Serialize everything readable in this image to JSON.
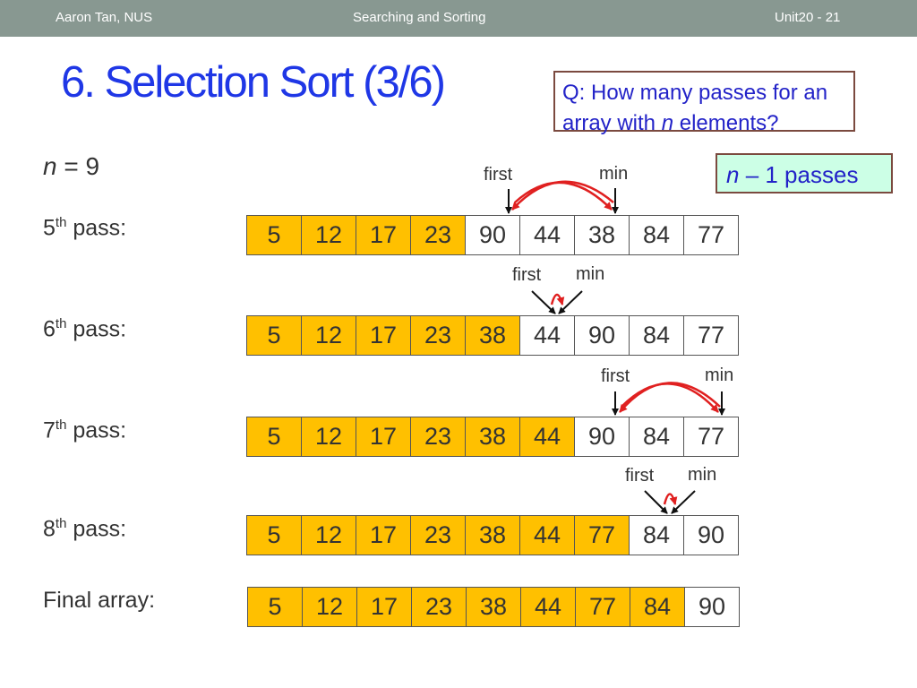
{
  "header": {
    "left": "Aaron Tan,  NUS",
    "center": "Searching and Sorting",
    "right": "Unit20 - 21"
  },
  "title": "6. Selection Sort (3/6)",
  "question": {
    "prefix": "Q: How many passes for an array with ",
    "n": "n",
    "suffix": " elements?"
  },
  "answer": {
    "n": "n",
    "text": " – 1 passes"
  },
  "n_label": {
    "n": "n",
    "text": " = 9"
  },
  "passes": [
    {
      "label_num": "5",
      "label_sup": "th",
      "label_suffix": " pass:",
      "values": [
        5,
        12,
        17,
        23,
        90,
        44,
        38,
        84,
        77
      ],
      "sorted_count": 4,
      "first_label": "first",
      "min_label": "min"
    },
    {
      "label_num": "6",
      "label_sup": "th",
      "label_suffix": " pass:",
      "values": [
        5,
        12,
        17,
        23,
        38,
        44,
        90,
        84,
        77
      ],
      "sorted_count": 5,
      "first_label": "first",
      "min_label": "min"
    },
    {
      "label_num": "7",
      "label_sup": "th",
      "label_suffix": " pass:",
      "values": [
        5,
        12,
        17,
        23,
        38,
        44,
        90,
        84,
        77
      ],
      "sorted_count": 6,
      "first_label": "first",
      "min_label": "min"
    },
    {
      "label_num": "8",
      "label_sup": "th",
      "label_suffix": " pass:",
      "values": [
        5,
        12,
        17,
        23,
        38,
        44,
        77,
        84,
        90
      ],
      "sorted_count": 7,
      "first_label": "first",
      "min_label": "min"
    }
  ],
  "final": {
    "label": "Final array:",
    "values": [
      5,
      12,
      17,
      23,
      38,
      44,
      77,
      84,
      90
    ],
    "sorted_count": 8
  },
  "colors": {
    "sorted": "#ffc000",
    "title": "#1f37e6",
    "swap_arrow": "#e02020"
  }
}
